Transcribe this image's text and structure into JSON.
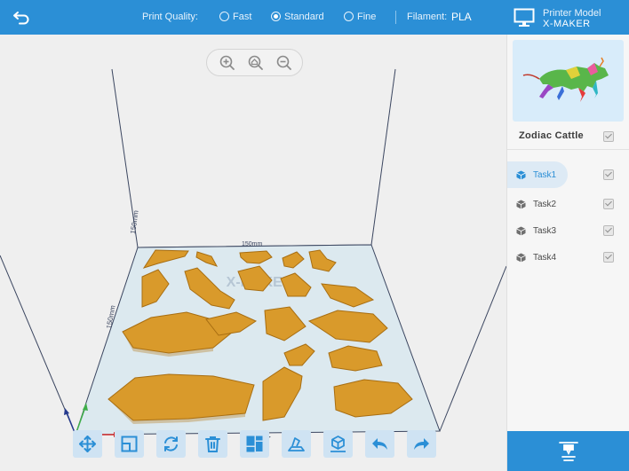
{
  "topbar": {
    "print_quality_label": "Print Quality:",
    "quality_options": [
      "Fast",
      "Standard",
      "Fine"
    ],
    "selected_quality": "Standard",
    "filament_label": "Filament:",
    "filament_value": "PLA",
    "printer_model_label": "Printer Model",
    "printer_model_value": "X-MAKER"
  },
  "viewport": {
    "dim_top": "150mm",
    "dim_left": "150mm",
    "dim_front": "150mm",
    "plate_logo": "X-MAKER",
    "part_color": "#d99a2b"
  },
  "toolbar": {
    "tools": [
      "move-icon",
      "scale-icon",
      "rotate-icon",
      "delete-icon",
      "arrange-icon",
      "lay-flat-icon",
      "add-model-icon",
      "undo-icon",
      "redo-icon"
    ]
  },
  "panel": {
    "model_name": "Zodiac Cattle",
    "tasks": [
      {
        "label": "Task1",
        "active": true
      },
      {
        "label": "Task2",
        "active": false
      },
      {
        "label": "Task3",
        "active": false
      },
      {
        "label": "Task4",
        "active": false
      }
    ]
  },
  "colors": {
    "accent": "#2b8fd6",
    "tool_bg": "#cfe3f3",
    "plate": "#dce9ef"
  }
}
